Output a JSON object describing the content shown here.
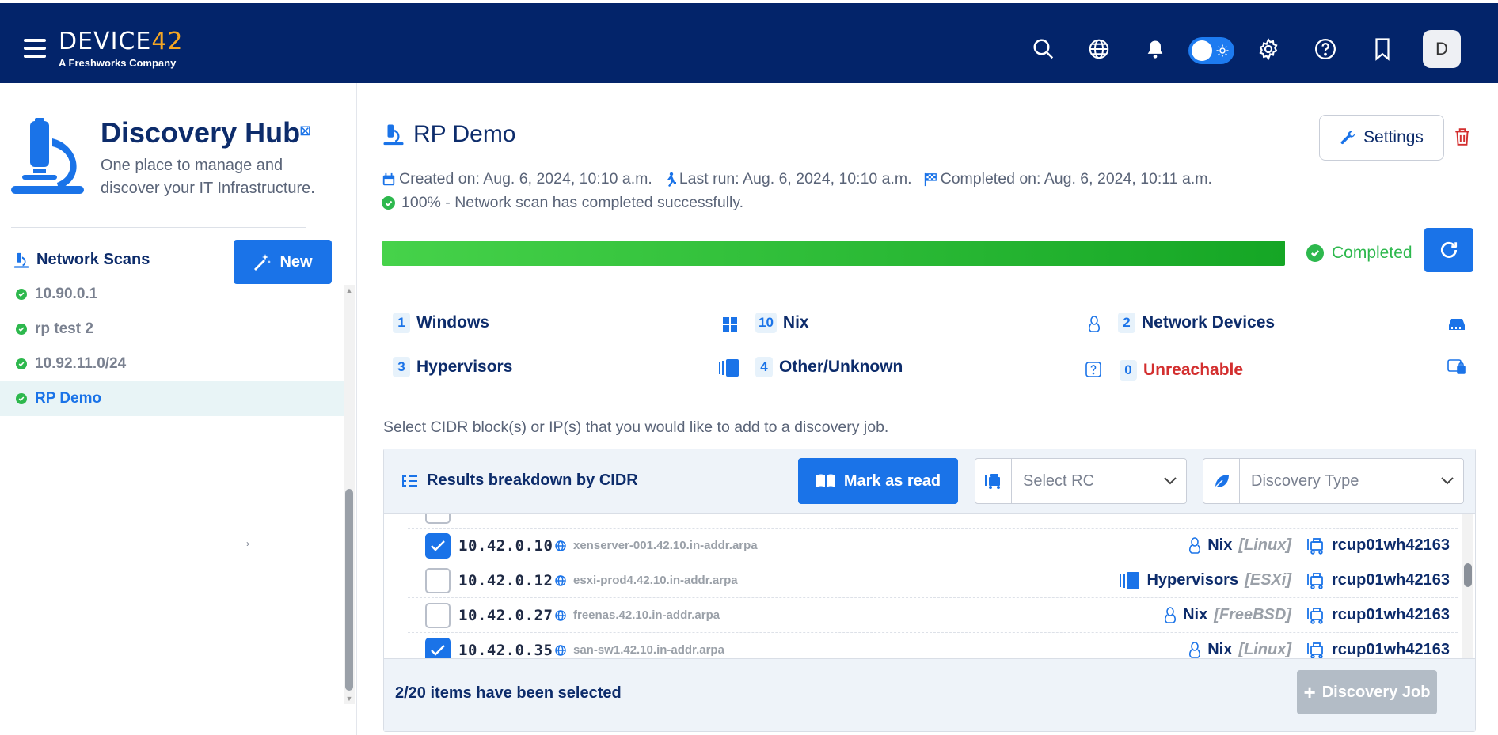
{
  "brand": {
    "logo_main": "DEVICE",
    "logo_accent": "42",
    "logo_sub": "A Freshworks Company"
  },
  "header_icons": [
    "search-icon",
    "globe-icon",
    "bell-icon",
    "theme-toggle",
    "gear-icon",
    "help-icon",
    "bookmark-icon"
  ],
  "user": {
    "avatar_letter": "D"
  },
  "hub": {
    "title": "Discovery Hub",
    "subtitle": "One place to manage and discover your IT Infrastructure."
  },
  "network_scans": {
    "heading": "Network Scans",
    "new_label": "New",
    "items": [
      {
        "label": "10.90.0.1",
        "active": false
      },
      {
        "label": "rp test 2",
        "active": false
      },
      {
        "label": "10.92.11.0/24",
        "active": false
      },
      {
        "label": "RP Demo",
        "active": true
      }
    ]
  },
  "scan": {
    "title": "RP Demo",
    "settings_label": "Settings",
    "created": "Created on: Aug. 6, 2024, 10:10 a.m.",
    "last_run": "Last run: Aug. 6, 2024, 10:10 a.m.",
    "completed_on": "Completed on: Aug. 6, 2024, 10:11 a.m.",
    "status_text": "100% - Network scan has completed successfully.",
    "progress_percent": 100,
    "status_label": "Completed"
  },
  "categories": [
    {
      "count": "1",
      "label": "Windows",
      "icon": "windows-icon"
    },
    {
      "count": "10",
      "label": "Nix",
      "icon": "linux-icon"
    },
    {
      "count": "2",
      "label": "Network Devices",
      "icon": "network-device-icon"
    },
    {
      "count": "3",
      "label": "Hypervisors",
      "icon": "hypervisor-icon"
    },
    {
      "count": "4",
      "label": "Other/Unknown",
      "icon": "unknown-icon"
    },
    {
      "count": "0",
      "label": "Unreachable",
      "icon": "unreachable-icon"
    }
  ],
  "hint": "Select CIDR block(s) or IP(s) that you would like to add to a discovery job.",
  "results": {
    "title": "Results breakdown by CIDR",
    "mark_read_label": "Mark as read",
    "select_rc_placeholder": "Select RC",
    "discovery_type_placeholder": "Discovery Type",
    "rows": [
      {
        "checked": true,
        "ip": "10.42.0.10",
        "host": "xenserver-001.42.10.in-addr.arpa",
        "type": "Nix",
        "subtype": "[Linux]",
        "rc": "rcup01wh42163"
      },
      {
        "checked": false,
        "ip": "10.42.0.12",
        "host": "esxi-prod4.42.10.in-addr.arpa",
        "type": "Hypervisors",
        "subtype": "[ESXi]",
        "rc": "rcup01wh42163"
      },
      {
        "checked": false,
        "ip": "10.42.0.27",
        "host": "freenas.42.10.in-addr.arpa",
        "type": "Nix",
        "subtype": "[FreeBSD]",
        "rc": "rcup01wh42163"
      },
      {
        "checked": true,
        "ip": "10.42.0.35",
        "host": "san-sw1.42.10.in-addr.arpa",
        "type": "Nix",
        "subtype": "[Linux]",
        "rc": "rcup01wh42163"
      }
    ],
    "selected_text": "2/20 items have been selected",
    "discovery_job_label": "Discovery Job"
  },
  "colors": {
    "nav": "#03246a",
    "accent": "#1a73e8",
    "success": "#2db84d",
    "danger": "#d32f2f",
    "logo_accent": "#f5a623"
  }
}
